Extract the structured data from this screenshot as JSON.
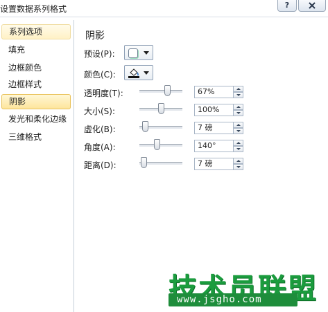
{
  "window": {
    "title": "设置数据系列格式",
    "help_label": "?"
  },
  "nav": {
    "items": [
      {
        "label": "系列选项"
      },
      {
        "label": "填充"
      },
      {
        "label": "边框颜色"
      },
      {
        "label": "边框样式"
      },
      {
        "label": "阴影"
      },
      {
        "label": "发光和柔化边缘"
      },
      {
        "label": "三维格式"
      }
    ],
    "selected": "阴影"
  },
  "panel": {
    "title": "阴影",
    "preset_label": "预设(P):",
    "color_label": "颜色(C):",
    "settings": [
      {
        "label": "透明度(T):",
        "value": "67%",
        "level": 0.67
      },
      {
        "label": "大小(S):",
        "value": "100%",
        "level": 0.5
      },
      {
        "label": "虚化(B):",
        "value": "7 磅",
        "level": 0.07
      },
      {
        "label": "角度(A):",
        "value": "140°",
        "level": 0.39
      },
      {
        "label": "距离(D):",
        "value": "7 磅",
        "level": 0.035
      }
    ]
  },
  "watermark": {
    "text": "技术员联盟",
    "url": "www.jsgho.com"
  },
  "colors": {
    "selected_bg": "#fde59c",
    "selected_border": "#e9c259",
    "watermark_green": "#1b9c3e"
  },
  "icons": {
    "close": "close-icon",
    "preset": "shadow-preset-icon",
    "color": "paint-bucket-icon"
  }
}
